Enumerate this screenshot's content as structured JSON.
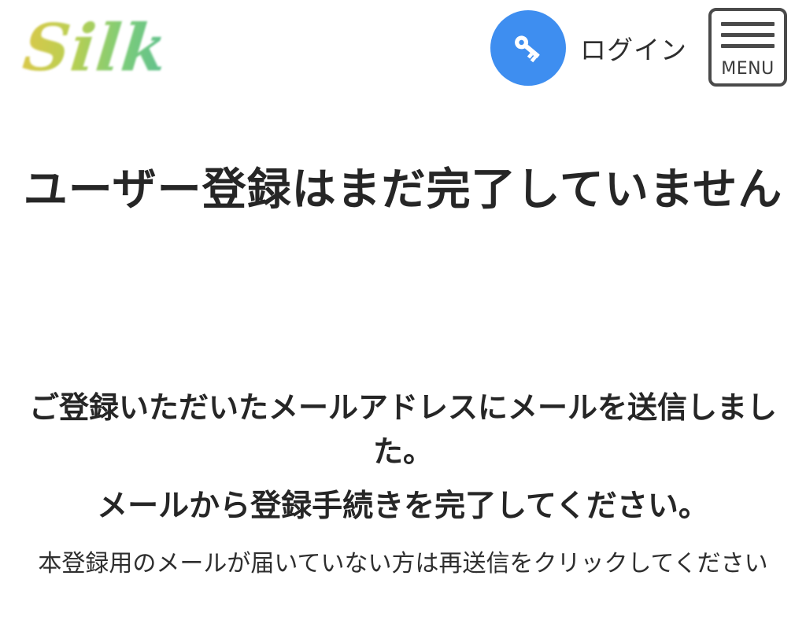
{
  "header": {
    "logo_text": "Silk",
    "login_label": "ログイン",
    "menu_label": "MENU"
  },
  "colors": {
    "login_circle": "#3e8ef0",
    "text": "#262626",
    "menu_border": "#4a4a4a"
  },
  "icons": {
    "login": "key-icon",
    "menu": "hamburger-icon"
  },
  "main": {
    "title": "ユーザー登録はまだ完了していません",
    "message_sent": "ご登録いただいたメールアドレスにメールを送信しました。",
    "message_complete": "メールから登録手続きを完了してください。",
    "resend_note": "本登録用のメールが届いていない方は再送信をクリックしてください"
  }
}
